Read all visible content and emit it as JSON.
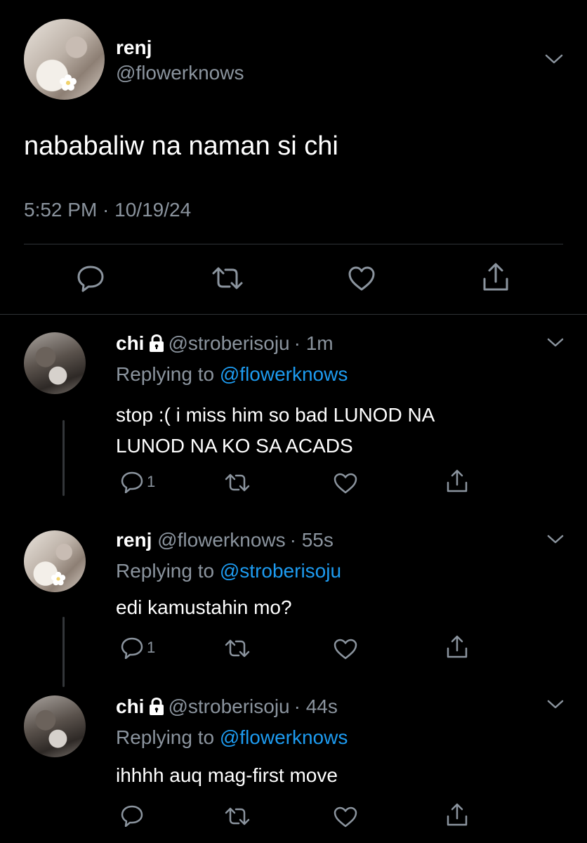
{
  "main_tweet": {
    "display_name": "renj",
    "handle": "@flowerknows",
    "text": "nababaliw na naman si chi",
    "timestamp": "5:52 PM · 10/19/24"
  },
  "replies": [
    {
      "display_name": "chi",
      "handle": "@stroberisoju",
      "time": "· 1m",
      "replying_prefix": "Replying to",
      "replying_to": "@flowerknows",
      "text_line1": "stop :( i miss him so bad LUNOD NA",
      "text_line2": "LUNOD NA KO SA ACADS",
      "reply_count": "1"
    },
    {
      "display_name": "renj",
      "handle": "@flowerknows",
      "time": "· 55s",
      "replying_prefix": "Replying to",
      "replying_to": "@stroberisoju",
      "text_line1": "edi kamustahin mo?",
      "reply_count": "1"
    },
    {
      "display_name": "chi",
      "handle": "@stroberisoju",
      "time": "· 44s",
      "replying_prefix": "Replying to",
      "replying_to": "@flowerknows",
      "text_line1": "ihhhh auq mag-first move"
    }
  ],
  "icons": [
    "chevron-down-icon",
    "reply-icon",
    "retweet-icon",
    "like-icon",
    "share-icon",
    "lock-icon",
    "flower-icon"
  ],
  "colors": {
    "background": "#000000",
    "muted": "#8b949e",
    "link": "#1d9bf0",
    "divider": "#2f3336"
  }
}
